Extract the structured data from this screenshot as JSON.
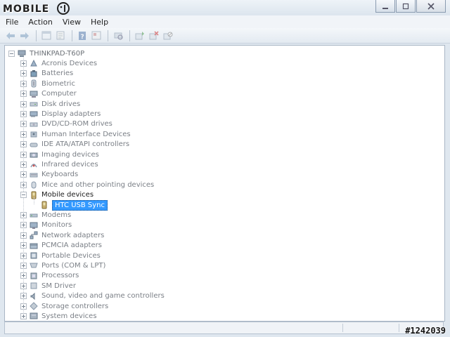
{
  "watermark": {
    "logo_text": "MOBILE01",
    "id_text": "#1242039"
  },
  "window": {
    "buttons": [
      "minimize",
      "maximize",
      "close"
    ]
  },
  "menu": {
    "file": "File",
    "action": "Action",
    "view": "View",
    "help": "Help"
  },
  "toolbar": {
    "buttons": [
      "back-icon",
      "forward-icon",
      "properties-icon",
      "console-tree-icon",
      "help-icon",
      "device-props-icon",
      "scan-hardware-icon",
      "update-driver-icon",
      "uninstall-icon",
      "disable-icon"
    ]
  },
  "tree": {
    "root": "THINKPAD-T60P",
    "categories": [
      {
        "label": "Acronis Devices",
        "icon": "acronis-icon",
        "expanded": false
      },
      {
        "label": "Batteries",
        "icon": "battery-icon",
        "expanded": false
      },
      {
        "label": "Biometric",
        "icon": "biometric-icon",
        "expanded": false
      },
      {
        "label": "Computer",
        "icon": "computer-icon",
        "expanded": false
      },
      {
        "label": "Disk drives",
        "icon": "disk-drive-icon",
        "expanded": false
      },
      {
        "label": "Display adapters",
        "icon": "display-adapter-icon",
        "expanded": false
      },
      {
        "label": "DVD/CD-ROM drives",
        "icon": "dvd-icon",
        "expanded": false
      },
      {
        "label": "Human Interface Devices",
        "icon": "hid-icon",
        "expanded": false
      },
      {
        "label": "IDE ATA/ATAPI controllers",
        "icon": "ide-icon",
        "expanded": false
      },
      {
        "label": "Imaging devices",
        "icon": "camera-icon",
        "expanded": false
      },
      {
        "label": "Infrared devices",
        "icon": "infrared-icon",
        "expanded": false
      },
      {
        "label": "Keyboards",
        "icon": "keyboard-icon",
        "expanded": false
      },
      {
        "label": "Mice and other pointing devices",
        "icon": "mouse-icon",
        "expanded": false
      },
      {
        "label": "Mobile devices",
        "icon": "mobile-device-icon",
        "expanded": true
      },
      {
        "label": "Modems",
        "icon": "modem-icon",
        "expanded": false
      },
      {
        "label": "Monitors",
        "icon": "monitor-icon",
        "expanded": false
      },
      {
        "label": "Network adapters",
        "icon": "network-icon",
        "expanded": false
      },
      {
        "label": "PCMCIA adapters",
        "icon": "pcmcia-icon",
        "expanded": false
      },
      {
        "label": "Portable Devices",
        "icon": "portable-device-icon",
        "expanded": false
      },
      {
        "label": "Ports (COM & LPT)",
        "icon": "port-icon",
        "expanded": false
      },
      {
        "label": "Processors",
        "icon": "processor-icon",
        "expanded": false
      },
      {
        "label": "SM Driver",
        "icon": "sm-driver-icon",
        "expanded": false
      },
      {
        "label": "Sound, video and game controllers",
        "icon": "sound-icon",
        "expanded": false
      },
      {
        "label": "Storage controllers",
        "icon": "storage-icon",
        "expanded": false
      },
      {
        "label": "System devices",
        "icon": "system-icon",
        "expanded": false
      }
    ],
    "child_of_mobile": {
      "label": "HTC USB Sync",
      "icon": "htc-phone-icon",
      "selected": true
    }
  },
  "colors": {
    "selection": "#3399ff",
    "text_dim": "#7a7f86",
    "window_bg": "#dfe7ef"
  }
}
